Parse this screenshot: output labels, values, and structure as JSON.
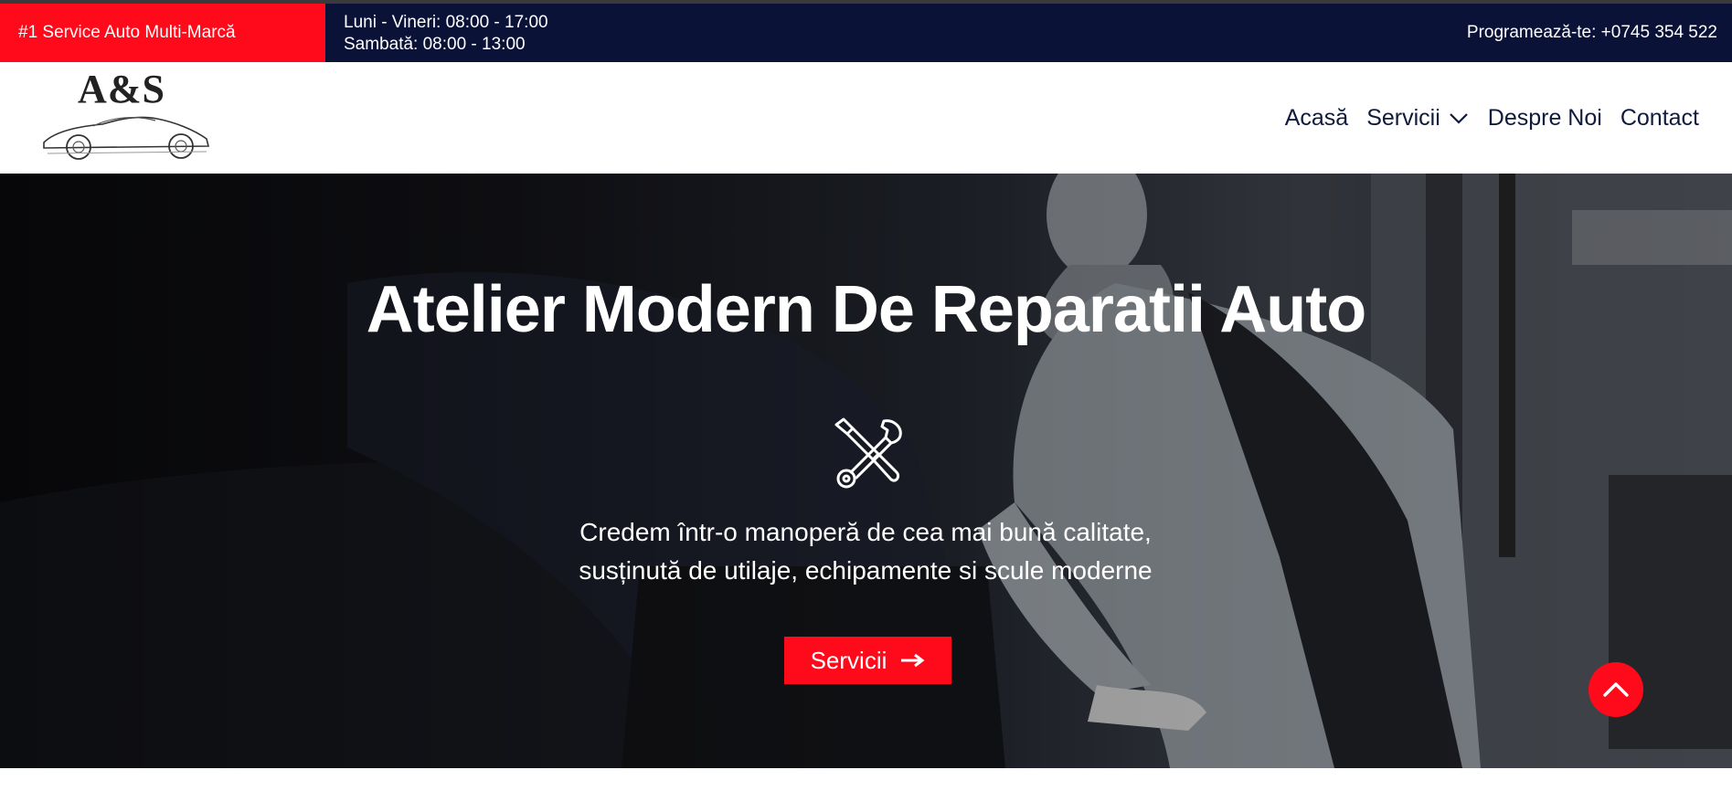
{
  "topbar": {
    "promo": "#1 Service Auto Multi-Marcă",
    "hours_weekdays": "Luni - Vineri: 08:00 - 17:00",
    "hours_saturday": "Sambată: 08:00 - 13:00",
    "phone": "Programează-te: +0745 354 522"
  },
  "logo": {
    "text": "A&S"
  },
  "nav": {
    "items": [
      {
        "label": "Acasă"
      },
      {
        "label": "Servicii",
        "icon": "chevron-down-icon"
      },
      {
        "label": "Despre Noi"
      },
      {
        "label": "Contact"
      }
    ]
  },
  "hero": {
    "title": "Atelier Modern De Reparatii Auto",
    "icon": "wrench-screwdriver-icon",
    "text_line1": "Credem într-o manoperă de cea mai bună calitate,",
    "text_line2": "susținută de utilaje, echipamente si scule moderne",
    "button_label": "Servicii",
    "button_icon": "arrow-right-icon"
  },
  "scroll_top": {
    "icon": "chevron-up-icon"
  },
  "colors": {
    "accent": "#ff0a1a",
    "topbar": "#0a1238",
    "nav_text": "#0f1a3d"
  }
}
